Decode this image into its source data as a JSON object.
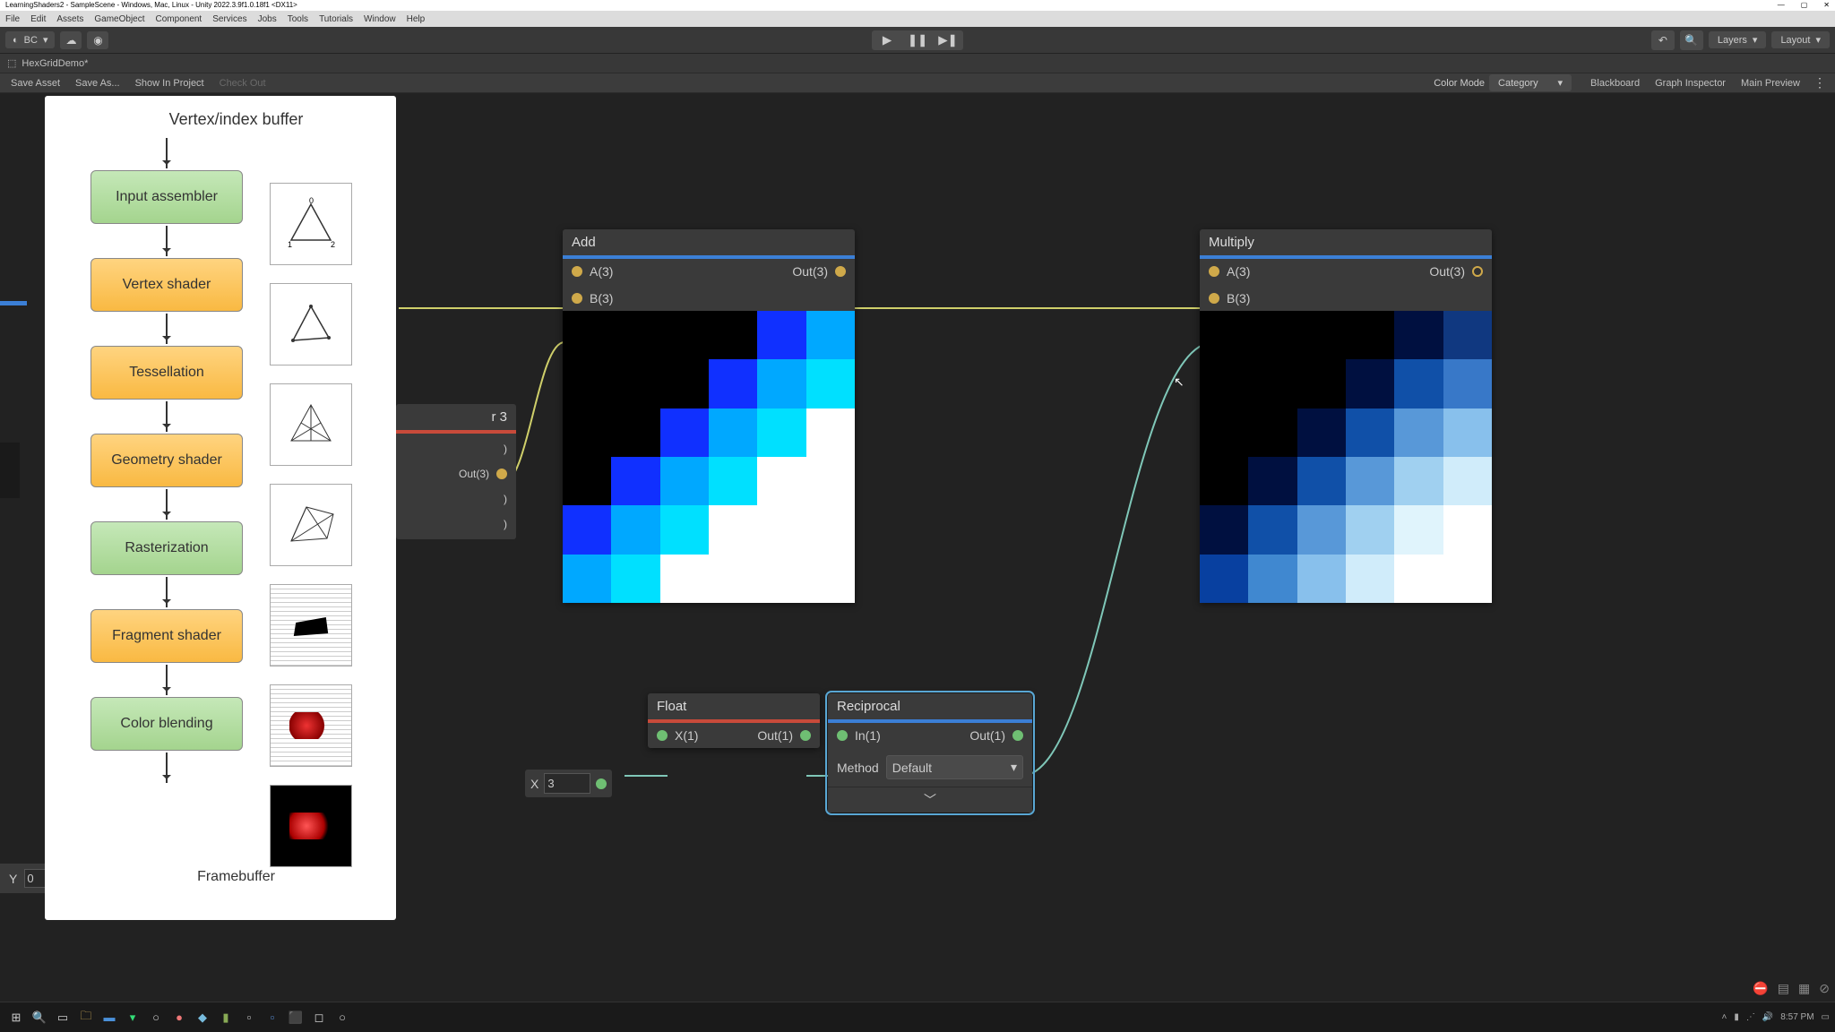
{
  "window_title": "LearningShaders2 - SampleScene - Windows, Mac, Linux - Unity 2022.3.9f1.0.18f1 <DX11>",
  "menubar": [
    "File",
    "Edit",
    "Assets",
    "GameObject",
    "Component",
    "Services",
    "Jobs",
    "Tools",
    "Tutorials",
    "Window",
    "Help"
  ],
  "account": "BC",
  "layers_label": "Layers",
  "layout_label": "Layout",
  "scene_tab": "HexGridDemo*",
  "shader_toolbar": {
    "save_asset": "Save Asset",
    "save_as": "Save As...",
    "show_in_project": "Show In Project",
    "check_out": "Check Out",
    "color_mode_label": "Color Mode",
    "color_mode_value": "Category",
    "blackboard": "Blackboard",
    "graph_inspector": "Graph Inspector",
    "main_preview": "Main Preview"
  },
  "pipeline": {
    "title": "Vertex/index buffer",
    "stages": [
      {
        "label": "Input assembler",
        "cls": "green"
      },
      {
        "label": "Vertex shader",
        "cls": "orange"
      },
      {
        "label": "Tessellation",
        "cls": "orange"
      },
      {
        "label": "Geometry shader",
        "cls": "orange"
      },
      {
        "label": "Rasterization",
        "cls": "green"
      },
      {
        "label": "Fragment shader",
        "cls": "orange"
      },
      {
        "label": "Color blending",
        "cls": "green"
      }
    ],
    "framebuffer": "Framebuffer"
  },
  "nodes": {
    "r3": {
      "title_suffix": "r 3",
      "out": "Out(3)"
    },
    "add": {
      "title": "Add",
      "a": "A(3)",
      "b": "B(3)",
      "out": "Out(3)"
    },
    "multiply": {
      "title": "Multiply",
      "a": "A(3)",
      "b": "B(3)",
      "out": "Out(3)"
    },
    "float": {
      "title": "Float",
      "x_label": "X",
      "x_value": "3",
      "x_port": "X(1)",
      "out": "Out(1)"
    },
    "reciprocal": {
      "title": "Reciprocal",
      "in": "In(1)",
      "out": "Out(1)",
      "method_label": "Method",
      "method_value": "Default"
    }
  },
  "y_field": {
    "label": "Y",
    "value": "0"
  },
  "taskbar_time": "8:57 PM"
}
